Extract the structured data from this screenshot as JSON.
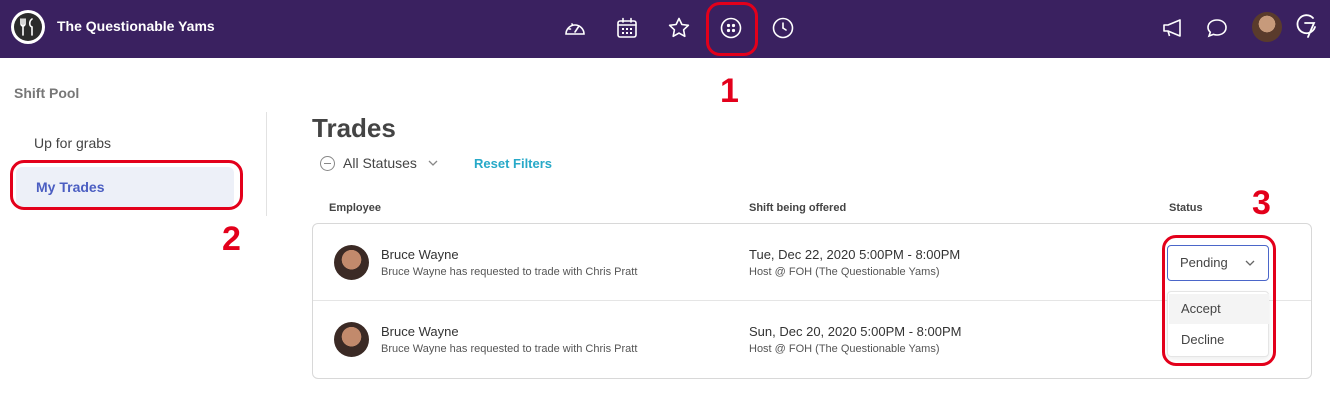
{
  "app": {
    "name": "The Questionable Yams"
  },
  "nav_icons": [
    "dashboard-icon",
    "calendar-icon",
    "star-icon",
    "apps-icon",
    "clock-icon"
  ],
  "right_icons": [
    "megaphone-icon",
    "chat-icon",
    "user-avatar",
    "brand-g7-icon"
  ],
  "sidebar": {
    "title": "Shift Pool",
    "items": [
      {
        "label": "Up for grabs",
        "active": false
      },
      {
        "label": "My Trades",
        "active": true
      }
    ]
  },
  "main": {
    "title": "Trades",
    "filter_label": "All Statuses",
    "reset_label": "Reset Filters",
    "columns": [
      "Employee",
      "Shift being offered",
      "Status"
    ],
    "rows": [
      {
        "name": "Bruce Wayne",
        "detail": "Bruce Wayne has requested to trade with Chris Pratt",
        "shift_time": "Tue, Dec 22, 2020 5:00PM - 8:00PM",
        "shift_location": "Host @ FOH (The Questionable Yams)"
      },
      {
        "name": "Bruce Wayne",
        "detail": "Bruce Wayne has requested to trade with Chris Pratt",
        "shift_time": "Sun, Dec 20, 2020 5:00PM - 8:00PM",
        "shift_location": "Host @ FOH (The Questionable Yams)"
      }
    ],
    "status_select": {
      "value": "Pending",
      "options": [
        "Accept",
        "Decline"
      ]
    }
  },
  "annotations": [
    "1",
    "2",
    "3"
  ],
  "colors": {
    "topbar": "#3a2160",
    "accent": "#4b5ec2",
    "link": "#27a9c8",
    "callout": "#e3001b"
  }
}
